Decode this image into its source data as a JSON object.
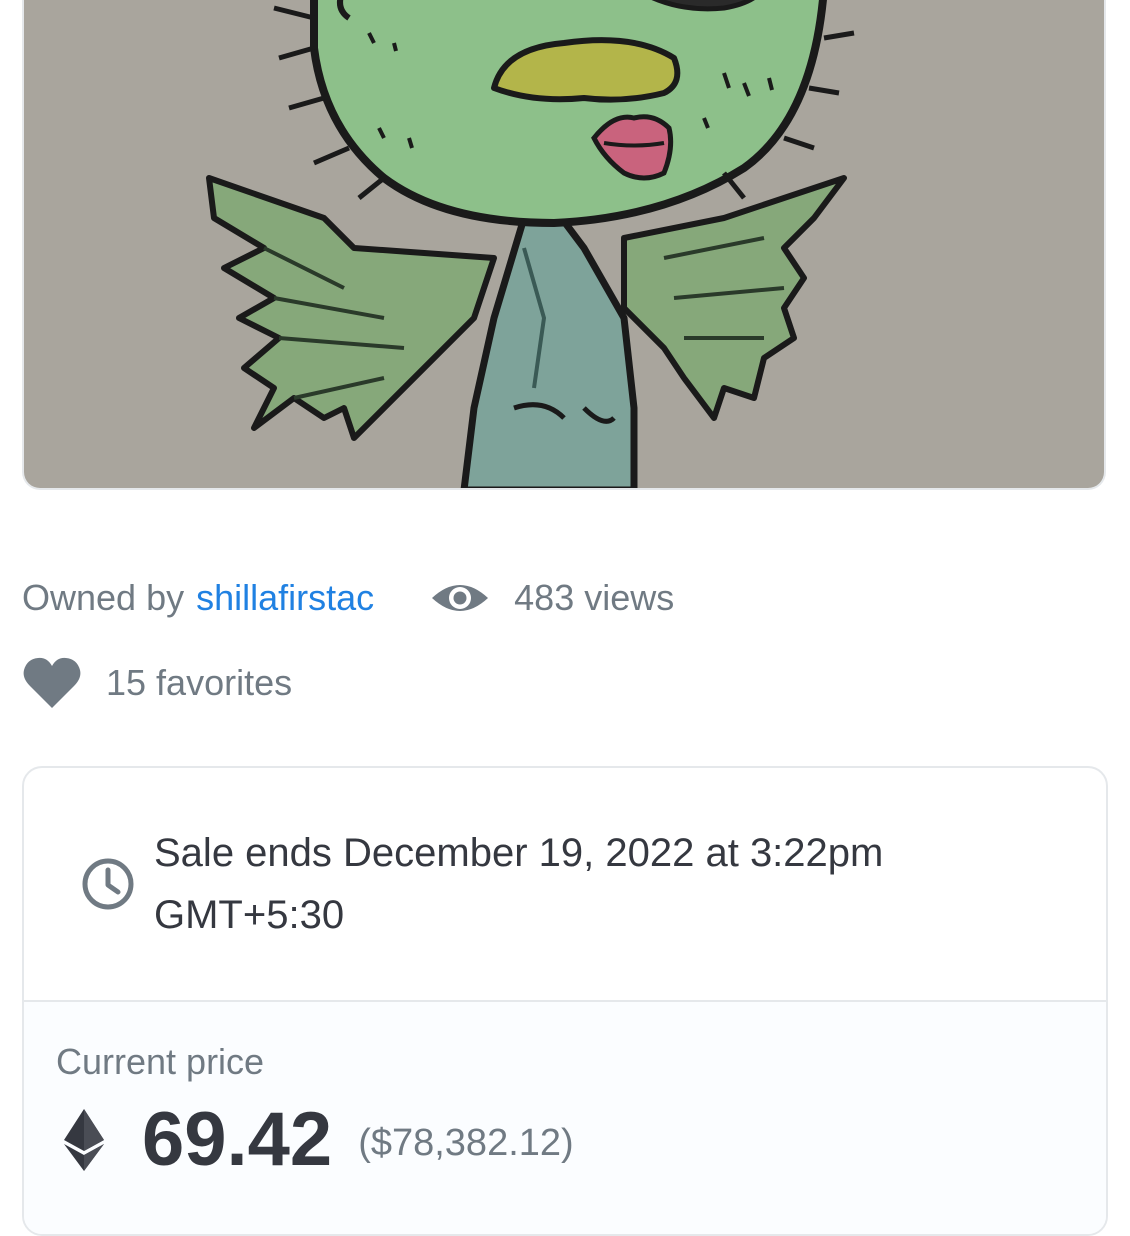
{
  "nft_image": {
    "icon": "nft-artwork-green-creature",
    "background_color": "#a9a59d"
  },
  "owner": {
    "prefix": "Owned by",
    "name": "shillafirstac",
    "link_color": "#2081e2"
  },
  "stats": {
    "views_label": "483 views",
    "views_icon": "eye-icon",
    "favorites_label": "15 favorites",
    "favorites_icon": "heart-icon"
  },
  "sale": {
    "icon": "clock-icon",
    "ends_text": "Sale ends December 19, 2022 at 3:22pm GMT+5:30"
  },
  "price": {
    "label": "Current price",
    "currency_icon": "ethereum-icon",
    "eth_value": "69.42",
    "usd_value": "($78,382.12)"
  }
}
